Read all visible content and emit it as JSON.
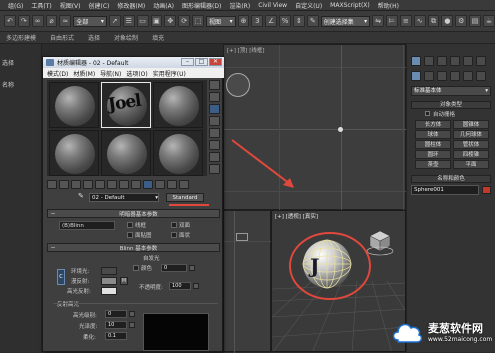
{
  "menubar": {
    "items": [
      "组(G)",
      "工具(T)",
      "视图(V)",
      "创建(C)",
      "修改器(M)",
      "动画(A)",
      "图形编辑器(D)",
      "渲染(R)",
      "Civil View",
      "自定义(U)",
      "MAXScript(X)",
      "帮助(H)"
    ]
  },
  "toolbar": {
    "filter_select": "全部",
    "view_select": "视图",
    "create_select": "创建选择集"
  },
  "ribbon": {
    "items": [
      "多边形建模",
      "自由形式",
      "选择",
      "对象绘制",
      "填充"
    ]
  },
  "left_panel": {
    "tab_label": "选择",
    "list_header": "名称"
  },
  "viewports": {
    "top_label": "[+] [顶] [线框]",
    "persp_label": "[+] [透视] [真实]"
  },
  "command_panel": {
    "dropdown_value": "标准基本体",
    "section_object_type": "对象类型",
    "autogrid_label": "自动栅格",
    "buttons": [
      "长方体",
      "圆锥体",
      "球体",
      "几何球体",
      "圆柱体",
      "管状体",
      "圆环",
      "四棱锥",
      "茶壶",
      "平面"
    ],
    "section_name_color": "名称和颜色",
    "object_name": "Sphere001",
    "object_color": "#c0392b"
  },
  "material_editor": {
    "title": "材质编辑器 - 02 - Default",
    "menu": [
      "模式(D)",
      "材质(M)",
      "导航(N)",
      "选项(O)",
      "实用程序(U)"
    ],
    "slot_texture_text": "Joel",
    "material_name": "02 - Default",
    "material_type": "Standard",
    "rollout_shader": "明暗器基本参数",
    "shader_select": "(B)Blinn",
    "shader_options": [
      "线框",
      "双面",
      "面贴图",
      "面状"
    ],
    "rollout_blinn": "Blinn 基本参数",
    "self_illum_label": "自发光",
    "color_label": "颜色",
    "color_value": "0",
    "ambient_label": "环境光:",
    "diffuse_label": "漫反射:",
    "specular_label": "高光反射:",
    "opacity_label": "不透明度:",
    "opacity_value": "100",
    "lock_glyph": "C",
    "map_button": "M",
    "rollout_specular": "反射高光",
    "spec_level_label": "高光级别:",
    "spec_level_value": "0",
    "glossiness_label": "光泽度:",
    "glossiness_value": "10",
    "soften_label": "柔化:",
    "soften_value": "0.1",
    "colors": {
      "ambient": "#4a4a4a",
      "diffuse": "#8a8a8a",
      "specular": "#e0e0e0"
    }
  },
  "watermark": {
    "brand": "麦葱软件网",
    "url": "www.52maicong.com"
  },
  "accent_colors": {
    "annotation_red": "#e0483c",
    "selection_blue": "#3c5d86"
  }
}
